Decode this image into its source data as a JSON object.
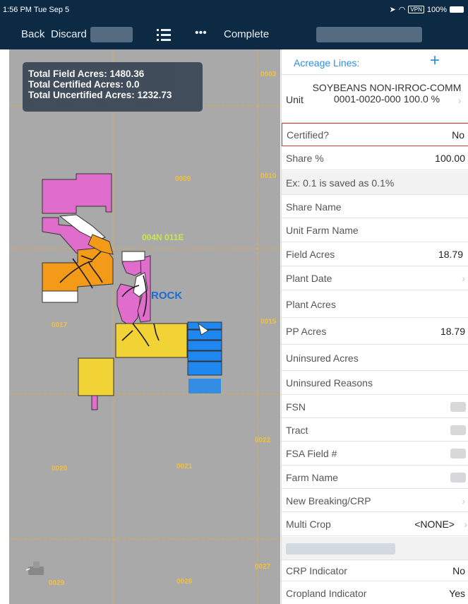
{
  "status": {
    "time": "1:56 PM  Tue Sep 5",
    "battery": "100%",
    "vpn": "VPN"
  },
  "nav": {
    "back": "Back",
    "discard": "Discard",
    "complete": "Complete",
    "more": "•••"
  },
  "map": {
    "legend": {
      "total_field": "Total Field Acres: 1480.36",
      "total_certified": "Total Certified Acres: 0.0",
      "total_uncertified": "Total Uncertified Acres: 1232.73"
    },
    "sections": [
      "0003",
      "0009",
      "0010",
      "0017",
      "0015",
      "0020",
      "0021",
      "0022",
      "0027",
      "0028",
      "0029"
    ],
    "township": "004N 011E",
    "place_label": "ROCK"
  },
  "panel": {
    "header": "Acreage Lines:",
    "add_icon": "+",
    "unit_label": "Unit",
    "unit_value": "SOYBEANS NON-IRROC-COMM 0001-0020-000 100.0 %",
    "rows": [
      {
        "label": "Certified?",
        "value": "No"
      },
      {
        "label": "Share %",
        "value": "100.00"
      },
      {
        "label": "Ex: 0.1 is saved as 0.1%",
        "value": ""
      },
      {
        "label": "Share Name",
        "value": ""
      },
      {
        "label": "Unit Farm Name",
        "value": ""
      },
      {
        "label": "Field Acres",
        "value": "18.79"
      },
      {
        "label": "Plant Date",
        "value": ""
      },
      {
        "label": "Plant Acres",
        "value": ""
      },
      {
        "label": "PP Acres",
        "value": "18.79"
      },
      {
        "label": "Uninsured Acres",
        "value": ""
      },
      {
        "label": "Uninsured Reasons",
        "value": ""
      },
      {
        "label": "FSN",
        "value": ""
      },
      {
        "label": "Tract",
        "value": ""
      },
      {
        "label": "FSA Field #",
        "value": ""
      },
      {
        "label": "Farm Name",
        "value": ""
      },
      {
        "label": "New Breaking/CRP",
        "value": ""
      },
      {
        "label": "Multi Crop",
        "value": "<NONE>"
      },
      {
        "label": "CRP Indicator",
        "value": "No"
      },
      {
        "label": "Cropland Indicator",
        "value": "Yes"
      }
    ]
  }
}
